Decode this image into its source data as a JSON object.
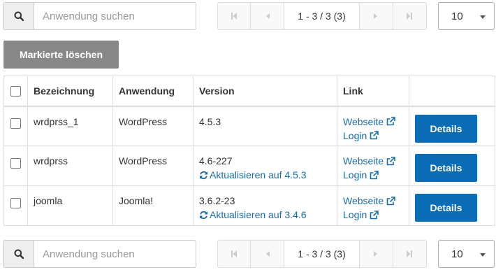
{
  "search": {
    "placeholder": "Anwendung suchen"
  },
  "pagination": {
    "info": "1 - 3 / 3 (3)"
  },
  "page_size": {
    "value": "10"
  },
  "delete_button": {
    "label": "Markierte löschen"
  },
  "table": {
    "headers": {
      "name": "Bezeichnung",
      "app": "Anwendung",
      "version": "Version",
      "link": "Link"
    },
    "rows": [
      {
        "name": "wrdprss_1",
        "app": "WordPress",
        "version": "4.5.3",
        "update": "",
        "website": "Webseite",
        "login": "Login",
        "details": "Details"
      },
      {
        "name": "wrdprss",
        "app": "WordPress",
        "version": "4.6-227",
        "update": "Aktualisieren auf 4.5.3",
        "website": "Webseite",
        "login": "Login",
        "details": "Details"
      },
      {
        "name": "joomla",
        "app": "Joomla!",
        "version": "3.6.2-23",
        "update": "Aktualisieren auf 3.4.6",
        "website": "Webseite",
        "login": "Login",
        "details": "Details"
      }
    ]
  },
  "colors": {
    "primary": "#0a6cb5",
    "link": "#1a6ca8",
    "delete_button": "#888888"
  },
  "icons": [
    "search-icon",
    "first-page-icon",
    "prev-page-icon",
    "next-page-icon",
    "last-page-icon",
    "external-link-icon",
    "refresh-icon",
    "caret-down-icon"
  ]
}
